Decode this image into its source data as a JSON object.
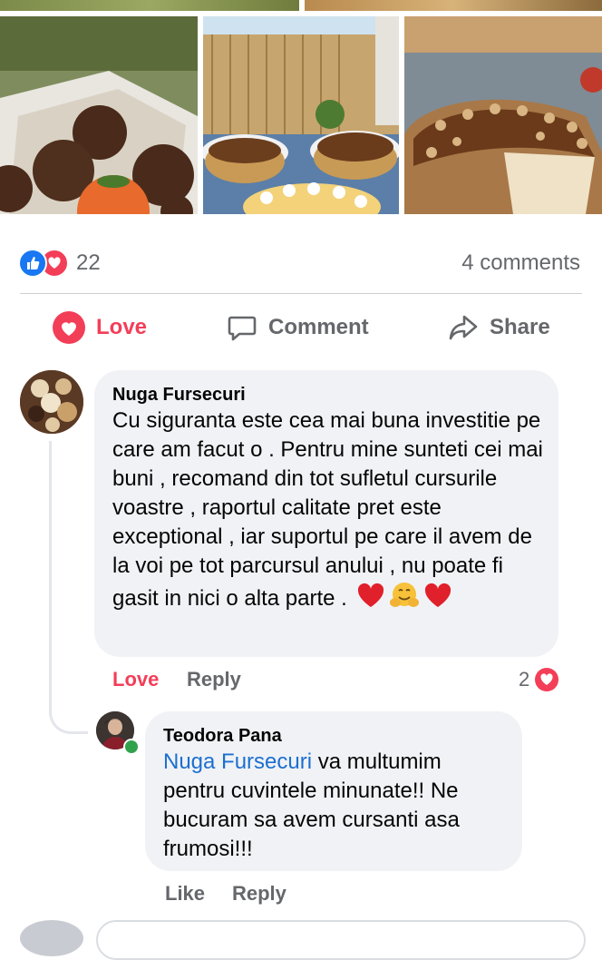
{
  "photos": [
    {
      "name": "chocolate-truffles-photo"
    },
    {
      "name": "cakes-on-balcony-photo"
    },
    {
      "name": "cheesecake-slice-photo"
    }
  ],
  "post_stats": {
    "reaction_icons": [
      "like-icon",
      "love-icon"
    ],
    "reaction_count": "22",
    "comments_count": "4 comments"
  },
  "actions": {
    "love_label": "Love",
    "comment_label": "Comment",
    "share_label": "Share",
    "love_color": "#f33e58",
    "muted_color": "#65676b"
  },
  "comments": [
    {
      "author": "Nuga Fursecuri",
      "text": "Cu siguranta este cea mai buna investitie pe care am facut o . Pentru mine sunteti cei mai buni , recomand din tot sufletul cursurile voastre , raportul calitate pret este exceptional , iar suportul pe care il avem de la voi pe tot parcursul anului , nu poate fi gasit in nici o alta parte .",
      "emojis": [
        "red-heart-emoji",
        "hugging-face-emoji",
        "red-heart-emoji"
      ],
      "reaction_label": "Love",
      "reply_label": "Reply",
      "reaction_count": "2"
    },
    {
      "author": "Teodora Pana",
      "mention": "Nuga Fursecuri",
      "text": "va multumim pentru cuvintele minunate!! Ne bucuram sa avem cursanti asa frumosi!!!",
      "like_label": "Like",
      "reply_label": "Reply",
      "online": true,
      "mention_color": "#1b6fd1"
    }
  ]
}
